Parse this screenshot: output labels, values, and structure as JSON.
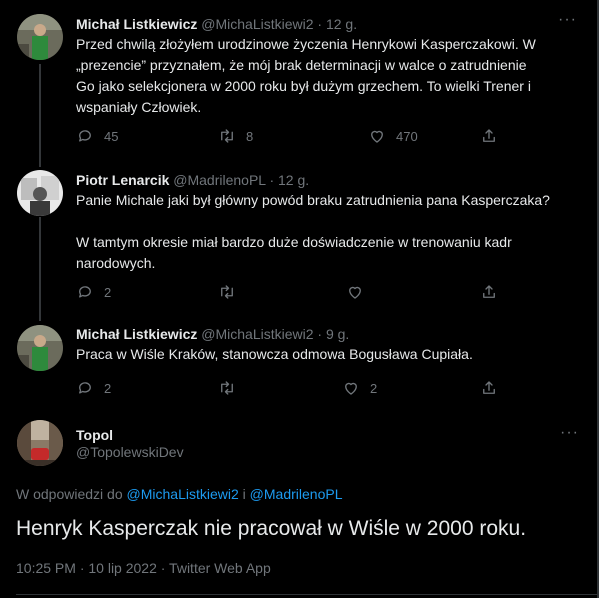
{
  "tweets": [
    {
      "name": "Michał Listkiewicz",
      "handle": "@MichaListkiewi2",
      "time": "12 g.",
      "text_lines": [
        "Przed chwilą złożyłem urodzinowe życzenia Henrykowi Kasperczakowi. W",
        "„prezencie” przyznałem, że mój brak determinacji w walce o zatrudnienie",
        "Go jako selekcjonera w 2000 roku był dużym grzechem. To wielki Trener i",
        "wspaniały Człowiek."
      ],
      "replies": "45",
      "retweets": "8",
      "likes": "470"
    },
    {
      "name": "Piotr Lenarcik",
      "handle": "@MadrilenoPL",
      "time": "12 g.",
      "text_lines": [
        "Panie Michale jaki był główny powód braku zatrudnienia pana Kasperczaka?",
        "",
        "W tamtym okresie miał bardzo duże doświadczenie w trenowaniu kadr",
        "narodowych."
      ],
      "replies": "2",
      "retweets": "",
      "likes": ""
    },
    {
      "name": "Michał Listkiewicz",
      "handle": "@MichaListkiewi2",
      "time": "9 g.",
      "text_lines": [
        "Praca w Wiśle Kraków, stanowcza odmowa Bogusława Cupiała."
      ],
      "replies": "2",
      "retweets": "",
      "likes": "2"
    }
  ],
  "focus": {
    "name": "Topol",
    "handle": "@TopolewskiDev",
    "reply_prefix": "W odpowiedzi do",
    "reply_user1": "@MichaListkiewi2",
    "reply_and": "i",
    "reply_user2": "@MadrilenoPL",
    "text": "Henryk Kasperczak nie pracował w Wiśle w 2000 roku.",
    "timestamp": "10:25 PM · 10 lip 2022 · Twitter Web App"
  },
  "ui": {
    "more_glyph": "···",
    "dot_sep": "·"
  },
  "icons": {
    "reply": "reply-icon",
    "retweet": "retweet-icon",
    "like": "like-icon",
    "share": "share-icon"
  },
  "colors": {
    "background": "#000000",
    "text": "#e7e9ea",
    "muted": "#71767b",
    "link": "#1d9bf0",
    "border": "#2f3336"
  }
}
